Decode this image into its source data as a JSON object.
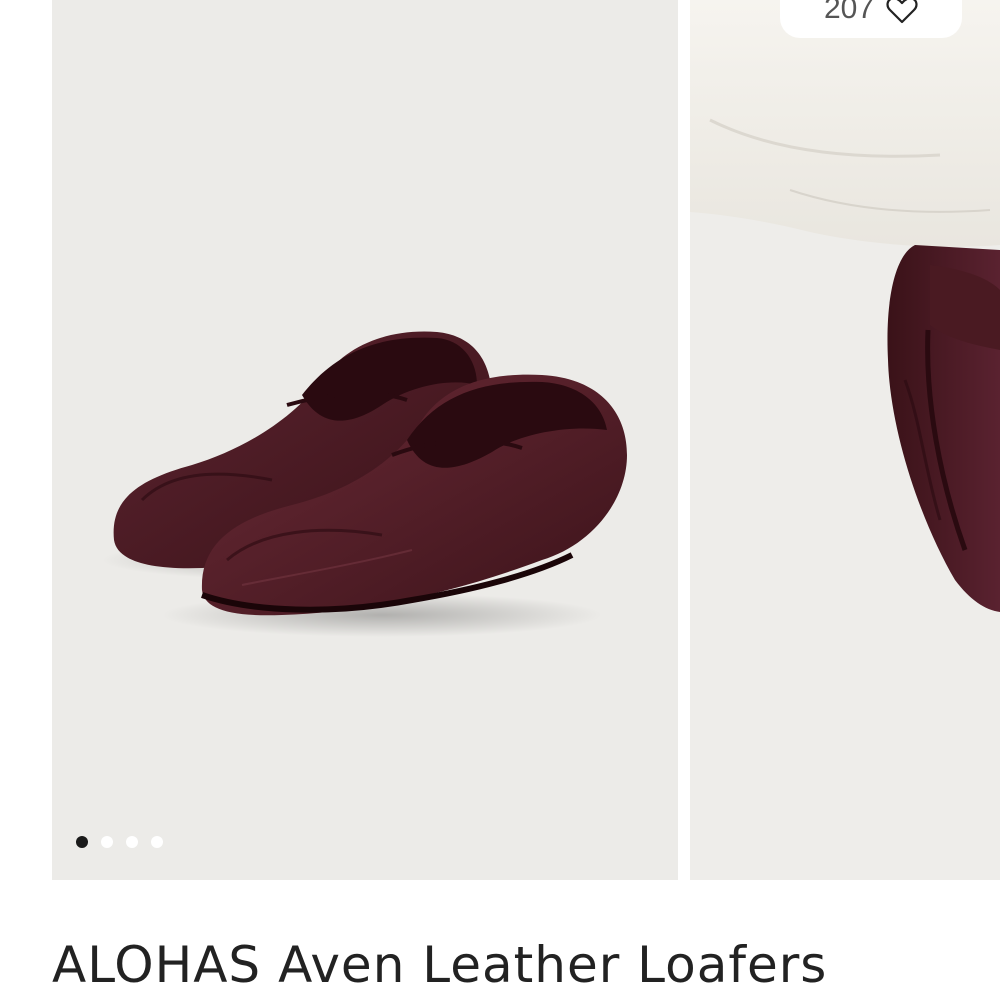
{
  "product": {
    "title": "ALOHAS Aven Leather Loafers",
    "like_count": "207"
  },
  "gallery": {
    "slide_count": 4,
    "active_index": 0,
    "images": [
      {
        "subject": "pair of burgundy leather penny loafers"
      },
      {
        "subject": "close-up of loafer worn under white trousers"
      }
    ]
  },
  "icons": {
    "like": "heart-outline-icon",
    "pagination": "dot-indicator"
  },
  "colors": {
    "leather": "#4a1a22",
    "background": "#ecebe8",
    "active_dot": "#1a1a1a"
  }
}
